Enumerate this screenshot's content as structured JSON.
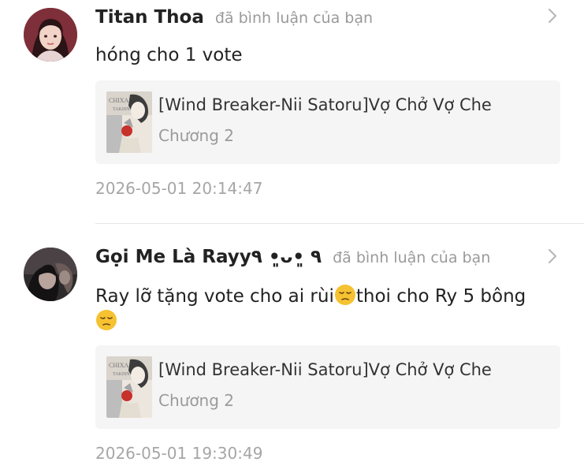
{
  "notifications": [
    {
      "username": "Titan Thoa",
      "action": "đã bình luận của bạn",
      "comment_parts": [
        "hóng cho 1 vote"
      ],
      "story": {
        "title": "[Wind Breaker-Nii Satoru]Vợ Chở Vợ Che",
        "chapter": "Chương 2"
      },
      "timestamp": "2026-05-01 20:14:47"
    },
    {
      "username": "Gọi Me Là Rayy٩ •͈ᴗ•͈ ٩",
      "action": "đã bình luận của bạn",
      "comment_parts": [
        "Ray lỡ tặng vote cho ai rùi",
        "thoi cho Ry 5 bông"
      ],
      "comment_emoji": "pensive-face-emoji",
      "story": {
        "title": "[Wind Breaker-Nii Satoru]Vợ Chở Vợ Che",
        "chapter": "Chương 2"
      },
      "timestamp": "2026-05-01 19:30:49"
    }
  ],
  "colors": {
    "username": "#222222",
    "action": "#9a9a9a",
    "card_bg": "#f5f5f6",
    "timestamp": "#a6a6a6",
    "divider": "#e6e6e6",
    "emoji": "#f6c232"
  },
  "icons": {
    "chevron": "chevron-right-icon"
  }
}
